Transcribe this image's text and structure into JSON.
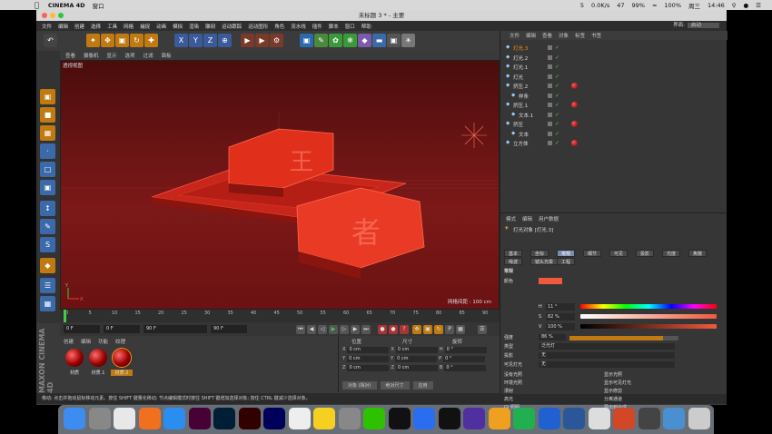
{
  "mac_menubar": {
    "app_name": "CINEMA 4D",
    "window_menu": "窗口",
    "status": {
      "mem1": "5",
      "disk": "47",
      "battery": "99%",
      "battery2": "100%",
      "net_up": "0.0K/s",
      "net_down": "0.0K/s",
      "day": "周三",
      "time": "14:46"
    }
  },
  "window": {
    "title": "未标题 3 * - 主要",
    "menu": [
      "文件",
      "编辑",
      "创建",
      "选择",
      "工具",
      "网格",
      "捕捉",
      "动画",
      "模拟",
      "渲染",
      "雕刻",
      "运动跟踪",
      "运动图形",
      "角色",
      "流水线",
      "插件",
      "脚本",
      "窗口",
      "帮助"
    ],
    "layout_label": "界面:",
    "layout_value": "启动"
  },
  "toolbar": {
    "axis_x": "X",
    "axis_y": "Y",
    "axis_z": "Z"
  },
  "viewport": {
    "menu": [
      "查看",
      "摄像机",
      "显示",
      "选项",
      "过滤",
      "面板"
    ],
    "title": "透视视图",
    "grid_info": "网格间距 : 100 cm",
    "axis_x": "X",
    "axis_y": "Y",
    "text_top": "王",
    "text_front": "者"
  },
  "timeline": {
    "ticks": [
      "0",
      "5",
      "10",
      "15",
      "20",
      "25",
      "30",
      "35",
      "40",
      "45",
      "50",
      "55",
      "60",
      "65",
      "70",
      "75",
      "80",
      "85",
      "90"
    ],
    "end_frame": "0 F",
    "current_frame": "0 F",
    "min_frame": "0 F",
    "max_frame": "90 F",
    "preview_max": "90 F"
  },
  "materials": {
    "menu": [
      "创建",
      "编辑",
      "功能",
      "纹理"
    ],
    "items": [
      {
        "label": "材质"
      },
      {
        "label": "材质.1"
      },
      {
        "label": "材质.2"
      }
    ]
  },
  "coordinates": {
    "headers": [
      "位置",
      "尺寸",
      "旋转"
    ],
    "rows": [
      {
        "axis": "X",
        "pos": "0 cm",
        "size": "0 cm",
        "rot_label": "H",
        "rot": "0 °"
      },
      {
        "axis": "Y",
        "pos": "0 cm",
        "size": "0 cm",
        "rot_label": "P",
        "rot": "0 °"
      },
      {
        "axis": "Z",
        "pos": "0 cm",
        "size": "0 cm",
        "rot_label": "B",
        "rot": "0 °"
      }
    ],
    "mode": "对象 (相对)",
    "size_mode": "绝对尺寸",
    "apply": "应用"
  },
  "status_bar": "移动: 点击并拖动鼠标移动元素。按住 SHIFT 键量化移动; 节点编辑模式时按住 SHIFT 键增加选择对象; 按住 CTRL 键减少选择对象。",
  "object_manager": {
    "menu": [
      "文件",
      "编辑",
      "查看",
      "对象",
      "标签",
      "书签"
    ],
    "objects": [
      {
        "name": "灯光.3",
        "indent": 0,
        "selected": true
      },
      {
        "name": "灯光.2",
        "indent": 0
      },
      {
        "name": "灯光.1",
        "indent": 0
      },
      {
        "name": "灯光",
        "indent": 0
      },
      {
        "name": "挤压.2",
        "indent": 0,
        "tag": true
      },
      {
        "name": "样条",
        "indent": 1
      },
      {
        "name": "挤压.1",
        "indent": 0,
        "tag": true
      },
      {
        "name": "文本.1",
        "indent": 1
      },
      {
        "name": "挤压",
        "indent": 0,
        "tag": true
      },
      {
        "name": "文本",
        "indent": 1
      },
      {
        "name": "立方体",
        "indent": 0,
        "tag": true
      }
    ]
  },
  "attributes": {
    "menu": [
      "模式",
      "编辑",
      "用户数据"
    ],
    "title": "灯光对象 [灯光.3]",
    "tabs_row1": [
      "基本",
      "坐标",
      "常规",
      "细节",
      "可见",
      "投影",
      "光度",
      "焦散"
    ],
    "tabs_row2": [
      "噪波",
      "镜头光晕",
      "工程"
    ],
    "active_tab": "常规",
    "section": "常规",
    "color_label": "颜色",
    "h_label": "H",
    "h_value": "11 °",
    "s_label": "S",
    "s_value": "82 %",
    "v_label": "V",
    "v_value": "100 %",
    "intensity_label": "强度",
    "intensity_value": "86 %",
    "type_label": "类型",
    "type_value": "泛光灯",
    "shadow_label": "投影",
    "shadow_value": "无",
    "visible_light_label": "可见灯光",
    "visible_light_value": "无",
    "check_rows": [
      {
        "left": "没有光照",
        "right": "显示光照"
      },
      {
        "left": "环境光照",
        "right": "显示可见灯光"
      },
      {
        "left": "漫射",
        "right": "显示修剪"
      },
      {
        "left": "高光",
        "right": "分离通道"
      },
      {
        "left": "GI 照明",
        "right": "导出到合成"
      }
    ],
    "color_hex": "#f05a3c"
  },
  "dock": {
    "apps": [
      "Finder",
      "Launchpad",
      "Chrome",
      "Firefox",
      "Safari",
      "Xd",
      "Ps",
      "Ai",
      "Ae",
      "App",
      "Notes",
      "Settings",
      "WeChat",
      "QQ",
      "VPN",
      "C4D",
      "RP",
      "Sketch",
      "Comm",
      "Baidu",
      "Word",
      "Mail",
      "PPT",
      "Photos",
      "Folder",
      "Trash"
    ]
  },
  "accent_colors": {
    "viewport_red": "#7c1818",
    "selection_orange": "#ff9900",
    "brand_red": "#e0301c"
  }
}
